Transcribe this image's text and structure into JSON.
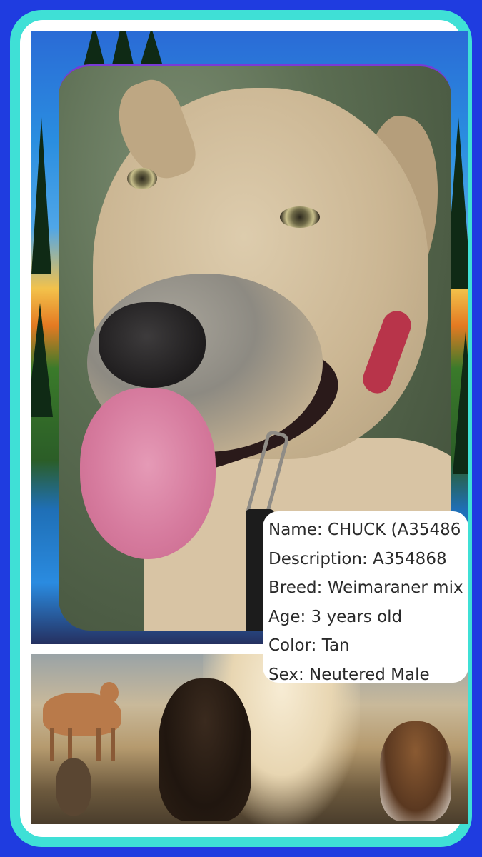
{
  "colors": {
    "background": "#1f3ce0",
    "frame": "#3fe0d6",
    "card": "#ffffff",
    "text": "#2a2a2a"
  },
  "images": {
    "background_scene": "sunset-forest-lake-painting",
    "main_photo": "tan-dog-tongue-out",
    "bottom_scene": "animals-painting"
  },
  "info": {
    "name": "Name: CHUCK (A35486",
    "description": "Description: A354868",
    "breed": "Breed: Weimaraner mix",
    "age": "Age: 3 years old",
    "color": "Color: Tan",
    "sex": "Sex: Neutered Male"
  }
}
